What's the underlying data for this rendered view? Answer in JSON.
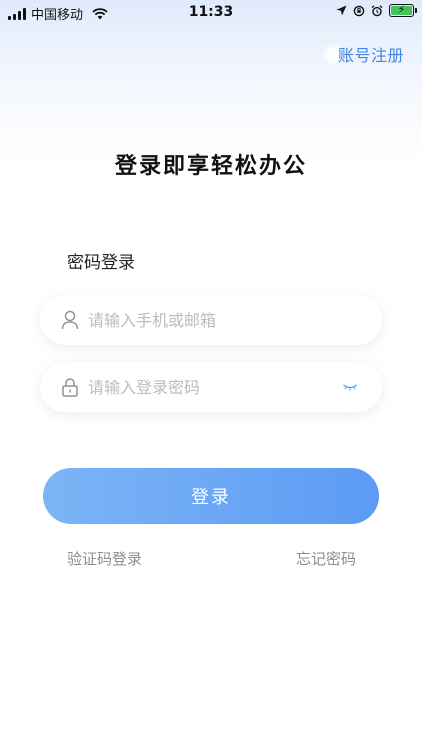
{
  "status_bar": {
    "carrier": "中国移动",
    "time": "11:33",
    "battery_level": 1.0,
    "battery_color": "#44c35a"
  },
  "header": {
    "register_label": "账号注册"
  },
  "main": {
    "title": "登录即享轻松办公",
    "section_label": "密码登录",
    "phone_field": {
      "value": "",
      "placeholder": "请输入手机或邮箱",
      "icon": "user-icon"
    },
    "password_field": {
      "value": "",
      "placeholder": "请输入登录密码",
      "icon": "lock-icon",
      "toggle_icon": "eye-closed-icon"
    },
    "login_label": "登录",
    "sms_login_label": "验证码登录",
    "forgot_password_label": "忘记密码"
  },
  "colors": {
    "accent": "#5b9bf4",
    "link": "#3d85e6",
    "muted": "#8a8d93"
  }
}
